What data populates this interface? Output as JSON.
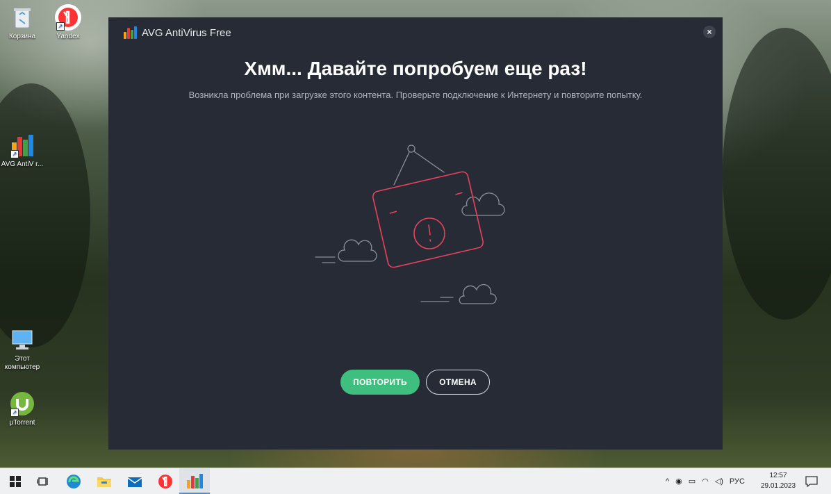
{
  "desktop": {
    "icons": [
      {
        "label": "Корзина",
        "icon": "recycle-bin-icon"
      },
      {
        "label": "Yandex",
        "icon": "yandex-browser-icon"
      },
      {
        "label": "AVG AntiV r...",
        "icon": "avg-antivirus-icon"
      },
      {
        "label": "Этот компьютер",
        "icon": "this-pc-icon"
      },
      {
        "label": "μTorrent",
        "icon": "utorrent-icon"
      }
    ]
  },
  "window": {
    "title": "AVG AntiVirus Free",
    "close_label": "×",
    "headline": "Хмм... Давайте попробуем еще раз!",
    "message": "Возникла проблема при загрузке этого контента. Проверьте подключение к Интернету и повторите попытку.",
    "retry_label": "ПОВТОРИТЬ",
    "cancel_label": "ОТМЕНА"
  },
  "taskbar": {
    "language": "РУС",
    "time": "12:57",
    "date": "29.01.2023"
  },
  "colors": {
    "window_bg": "#262b35",
    "accent_green": "#3fbf7f",
    "illustration_red": "#e8425d",
    "illustration_line": "#8a909c"
  }
}
